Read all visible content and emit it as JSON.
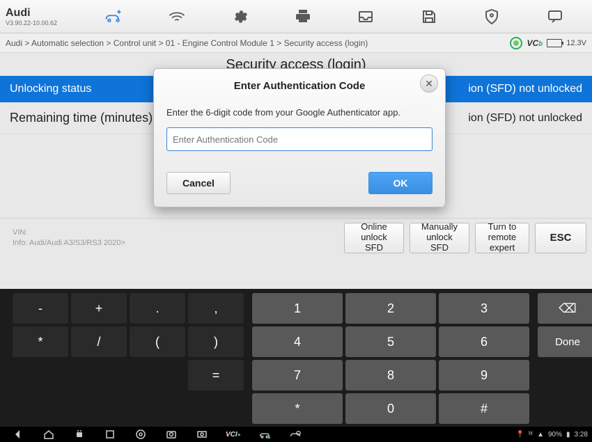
{
  "header": {
    "brand_title": "Audi",
    "brand_version": "V3.90.22-10.00.62"
  },
  "breadcrumb": {
    "path": "Audi > Automatic selection > Control unit > 01 - Engine Control Module 1 > Security access (login)",
    "vcb_label": "VCb",
    "voltage": "12.3V"
  },
  "page": {
    "title": "Security access (login)",
    "rows": [
      {
        "label": "Unlocking status",
        "value": "ion (SFD) not unlocked"
      },
      {
        "label": "Remaining time (minutes)",
        "value": "ion (SFD) not unlocked"
      }
    ],
    "vin_label": "VIN:",
    "info_label": "Info: Audi/Audi A3/S3/RS3 2020>"
  },
  "footer": {
    "online_unlock": "Online unlock SFD",
    "manual_unlock": "Manually unlock SFD",
    "remote_expert": "Turn to remote expert",
    "esc": "ESC"
  },
  "modal": {
    "title": "Enter Authentication Code",
    "message": "Enter the 6-digit code from your Google Authenticator app.",
    "placeholder": "Enter Authentication Code",
    "cancel": "Cancel",
    "ok": "OK"
  },
  "keyboard": {
    "left": [
      "-",
      "+",
      ".",
      ",",
      "*",
      "/",
      "(",
      ")",
      "",
      "=",
      "",
      "",
      "*",
      "#"
    ],
    "mid": [
      "1",
      "2",
      "3",
      "4",
      "5",
      "6",
      "7",
      "8",
      "9",
      "*",
      "0",
      "#"
    ],
    "backspace_icon": "⌫",
    "done": "Done"
  },
  "sysbar": {
    "right_text": "90%",
    "time": "3:28"
  }
}
